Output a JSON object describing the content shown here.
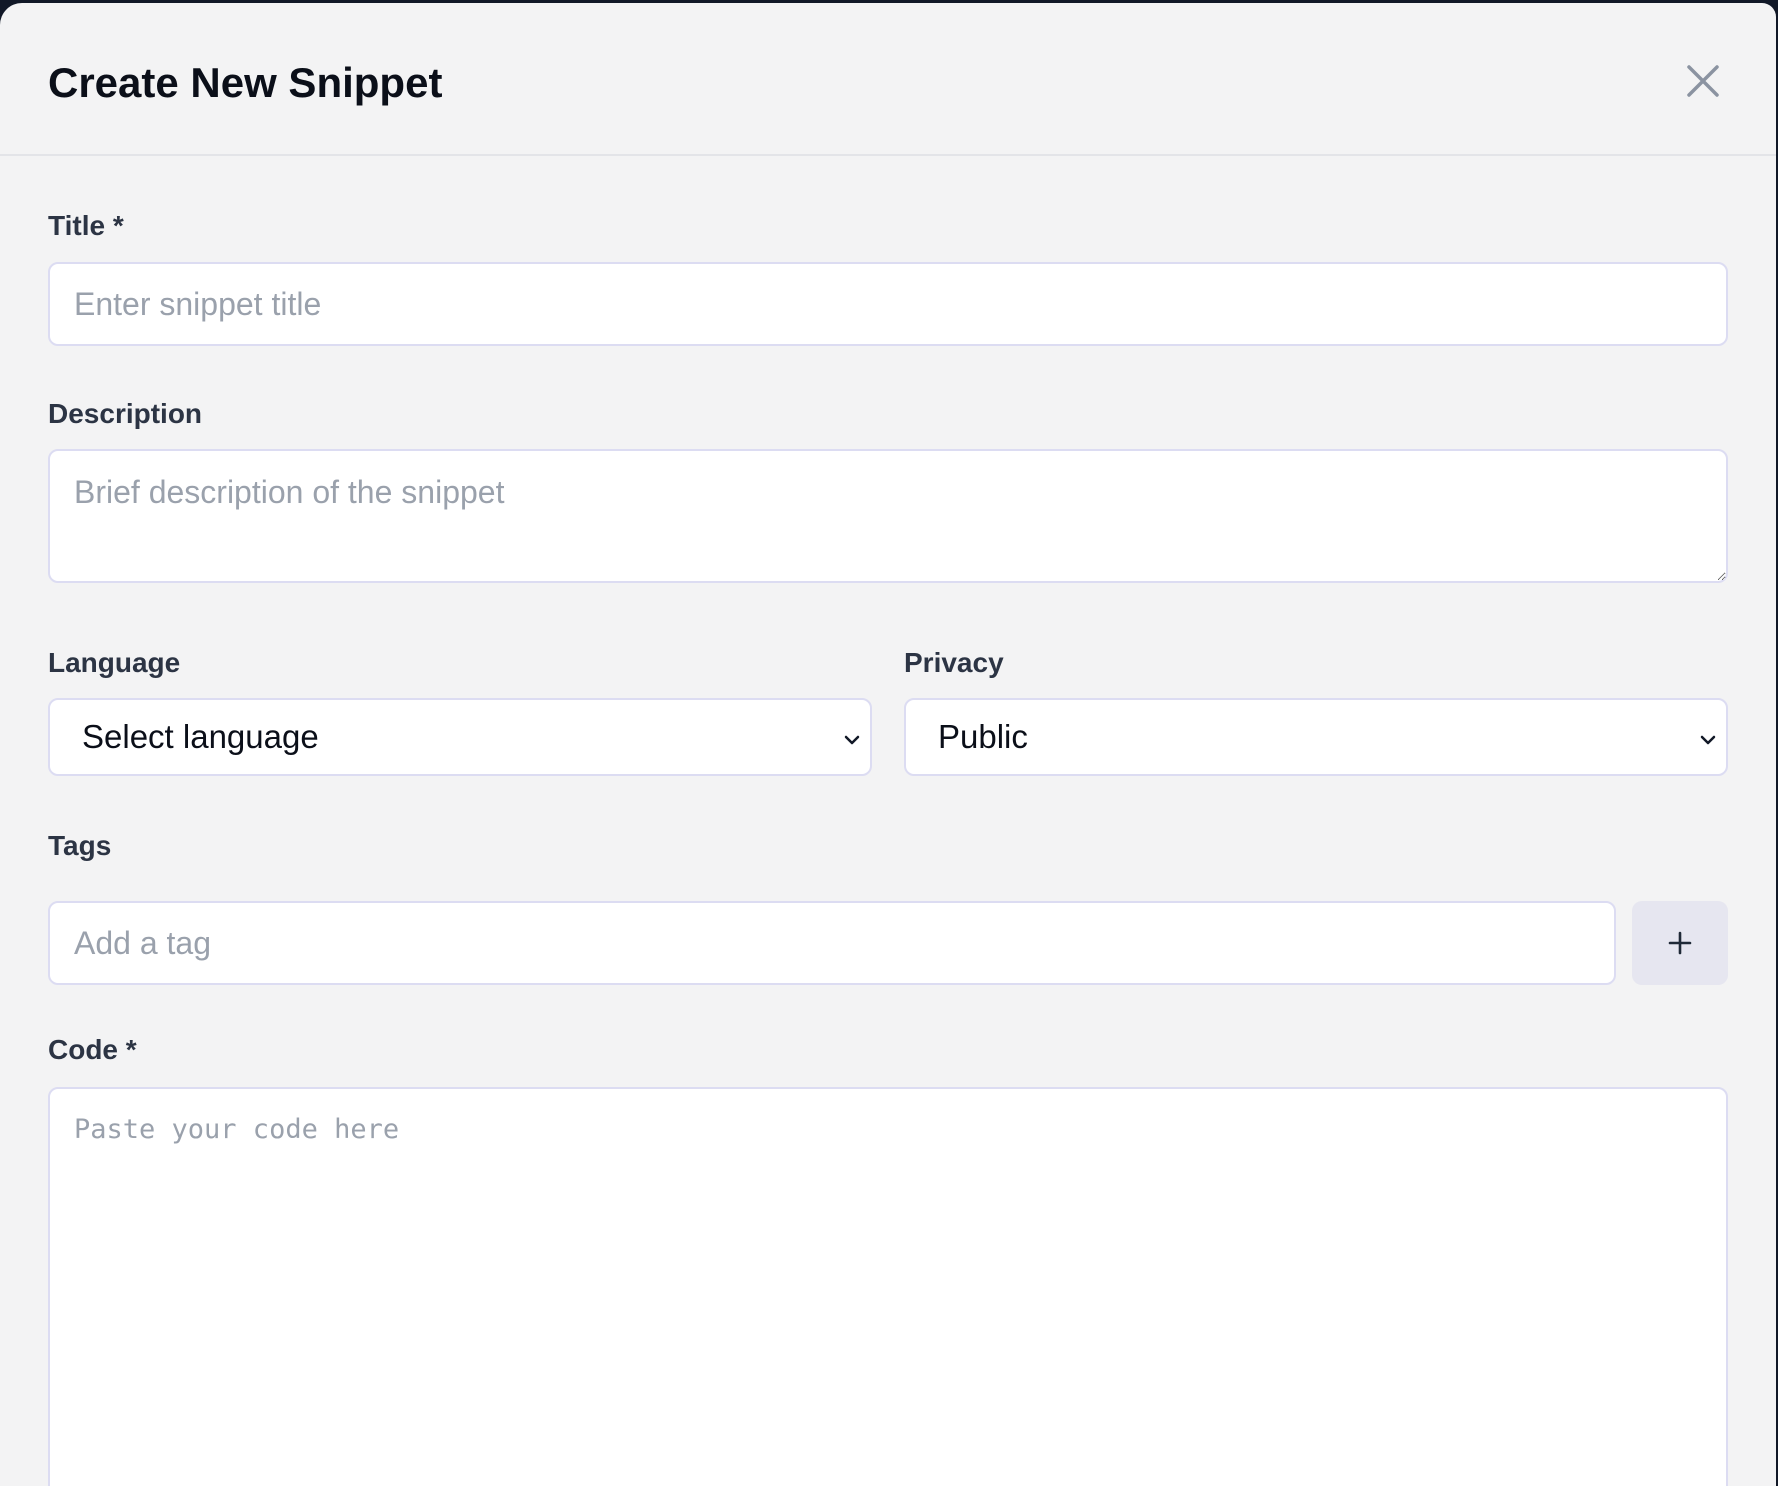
{
  "dialog": {
    "title": "Create New Snippet",
    "close_icon": "close-icon"
  },
  "form": {
    "title": {
      "label": "Title *",
      "placeholder": "Enter snippet title",
      "value": ""
    },
    "description": {
      "label": "Description",
      "placeholder": "Brief description of the snippet",
      "value": ""
    },
    "language": {
      "label": "Language",
      "selected": "Select language",
      "icon": "chevron-down-icon"
    },
    "privacy": {
      "label": "Privacy",
      "selected": "Public",
      "icon": "chevron-down-icon"
    },
    "tags": {
      "label": "Tags",
      "placeholder": "Add a tag",
      "value": "",
      "add_icon": "plus-icon"
    },
    "code": {
      "label": "Code *",
      "placeholder": "Paste your code here",
      "value": ""
    }
  },
  "colors": {
    "background": "#f3f3f4",
    "overlay": "#111827",
    "field_border": "#dcdcf2",
    "label_text": "#2c3444",
    "placeholder_text": "#9aa1ac",
    "add_button_bg": "#e6e6f0"
  }
}
